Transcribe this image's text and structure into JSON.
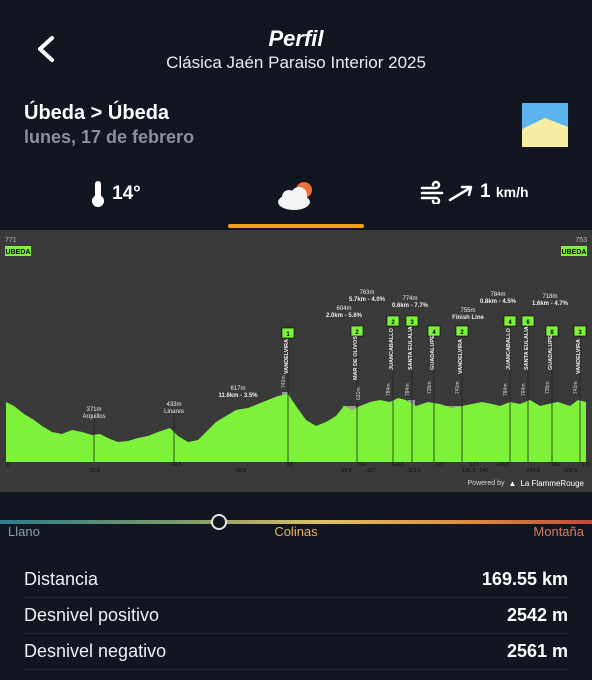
{
  "header": {
    "title": "Perfil",
    "subtitle": "Clásica Jaén Paraiso Interior 2025"
  },
  "stage": {
    "route": "Úbeda > Úbeda",
    "date": "lunes, 17 de febrero"
  },
  "weather": {
    "temperature": "14°",
    "wind_value": "1",
    "wind_unit": "km/h",
    "icons": [
      "thermometer-icon",
      "cloud-sun-icon",
      "wind-icon"
    ]
  },
  "profile": {
    "left_elevation": "771",
    "right_elevation": "753",
    "start_label": "UBEDA",
    "finish_label": "UBEDA",
    "powered_by": "Powered by",
    "brand": "La FlammeRouge",
    "x_ticks": [
      "0",
      "25.5",
      "49.5",
      "68.5",
      "83",
      "99.5",
      "104",
      "107",
      "114.5",
      "119.5",
      "127",
      "135.5",
      "137",
      "140",
      "145.5",
      "154.5",
      "161",
      "165.5",
      "170"
    ],
    "towns": [
      {
        "elev": "371m",
        "name": "Arquillos"
      },
      {
        "elev": "433m",
        "name": "Linares"
      }
    ],
    "climb_stats": [
      {
        "text": "617m",
        "sub": "11.6km - 3.5%"
      },
      {
        "text": "604m",
        "sub": "2.0km - 5.6%"
      },
      {
        "text": "763m",
        "sub": "5.7km - 4.0%"
      },
      {
        "text": "774m",
        "sub": "0.6km - 7.7%"
      },
      {
        "text": "755m",
        "sub": "Finish Line"
      },
      {
        "text": "784m",
        "sub": "0.8km - 4.5%"
      },
      {
        "text": "718m",
        "sub": "1.6km - 4.7%"
      }
    ],
    "climb_names": [
      "VANDELVIRA",
      "MAR DE OLIVOS",
      "JUANCABALLO",
      "SANTA EULALIA",
      "GUADALUPE",
      "VANDELVIRA",
      "JUANCABALLO",
      "SANTA EULALIA",
      "GUADALUPE",
      "VANDELVIRA"
    ],
    "climb_cats": [
      "1",
      "2",
      "2",
      "3",
      "4",
      "2",
      "4",
      "6",
      "8",
      "3"
    ],
    "small_elevs": [
      "741m",
      "631m",
      "784m",
      "784m",
      "735m",
      "741m",
      "784m",
      "764m",
      "735m",
      "741m"
    ]
  },
  "difficulty": {
    "low": "Llano",
    "mid": "Colinas",
    "high": "Montaña",
    "level": 0.37
  },
  "stats": [
    {
      "label": "Distancia",
      "value": "169.55 km"
    },
    {
      "label": "Desnivel positivo",
      "value": "2542 m"
    },
    {
      "label": "Desnivel negativo",
      "value": "2561 m"
    }
  ],
  "colors": {
    "background": "#121621",
    "accent": "#f5a11c",
    "profile_green": "#7ef23a",
    "profile_bg": "#3a3a3a"
  }
}
